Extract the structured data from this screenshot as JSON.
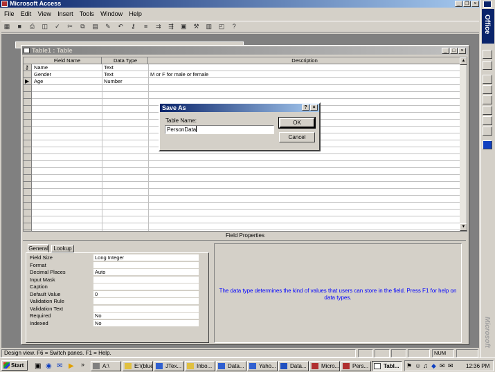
{
  "app": {
    "title": "Microsoft Access",
    "menu": [
      "File",
      "Edit",
      "View",
      "Insert",
      "Tools",
      "Window",
      "Help"
    ]
  },
  "table_window": {
    "title": "Table1 : Table",
    "columns": [
      "Field Name",
      "Data Type",
      "Description"
    ],
    "rows": [
      {
        "name": "Name",
        "type": "Text",
        "desc": ""
      },
      {
        "name": "Gender",
        "type": "Text",
        "desc": "M or F for male or female"
      },
      {
        "name": "Age",
        "type": "Number",
        "desc": ""
      }
    ],
    "field_properties_label": "Field Properties",
    "tabs": [
      "General",
      "Lookup"
    ],
    "properties": [
      {
        "label": "Field Size",
        "value": "Long Integer"
      },
      {
        "label": "Format",
        "value": ""
      },
      {
        "label": "Decimal Places",
        "value": "Auto"
      },
      {
        "label": "Input Mask",
        "value": ""
      },
      {
        "label": "Caption",
        "value": ""
      },
      {
        "label": "Default Value",
        "value": "0"
      },
      {
        "label": "Validation Rule",
        "value": ""
      },
      {
        "label": "Validation Text",
        "value": ""
      },
      {
        "label": "Required",
        "value": "No"
      },
      {
        "label": "Indexed",
        "value": "No"
      }
    ],
    "help_text": "The data type determines the kind of values that users can store in the field.  Press F1 for help on data types."
  },
  "dialog": {
    "title": "Save As",
    "label": "Table Name:",
    "value": "PersonData",
    "ok": "OK",
    "cancel": "Cancel",
    "help_btn": "?",
    "close_btn": "×"
  },
  "status": {
    "text": "Design view.  F6 = Switch panes.  F1 = Help.",
    "num": "NUM"
  },
  "office_bar": {
    "label": "Office",
    "brand": "Microsoft"
  },
  "taskbar": {
    "start": "Start",
    "buttons": [
      "A:\\",
      "E:\\(blue)",
      "JTex...",
      "Inbo...",
      "Data...",
      "Yaho...",
      "Data...",
      "Micro...",
      "Pers...",
      "Tabl..."
    ],
    "clock": "12:36 PM"
  },
  "colors": {
    "titlebar": "#0a246a",
    "desktop": "#808080",
    "help_text": "#0000ff"
  }
}
